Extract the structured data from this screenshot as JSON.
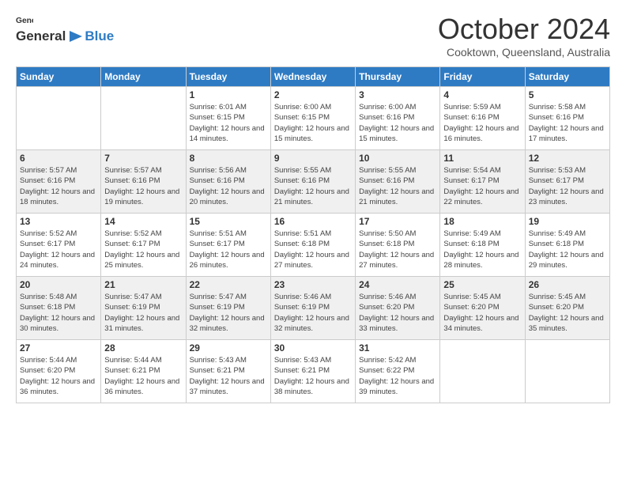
{
  "logo": {
    "general": "General",
    "blue": "Blue"
  },
  "header": {
    "title": "October 2024",
    "subtitle": "Cooktown, Queensland, Australia"
  },
  "weekdays": [
    "Sunday",
    "Monday",
    "Tuesday",
    "Wednesday",
    "Thursday",
    "Friday",
    "Saturday"
  ],
  "weeks": [
    [
      null,
      null,
      {
        "day": "1",
        "sunrise": "Sunrise: 6:01 AM",
        "sunset": "Sunset: 6:15 PM",
        "daylight": "Daylight: 12 hours and 14 minutes."
      },
      {
        "day": "2",
        "sunrise": "Sunrise: 6:00 AM",
        "sunset": "Sunset: 6:15 PM",
        "daylight": "Daylight: 12 hours and 15 minutes."
      },
      {
        "day": "3",
        "sunrise": "Sunrise: 6:00 AM",
        "sunset": "Sunset: 6:16 PM",
        "daylight": "Daylight: 12 hours and 15 minutes."
      },
      {
        "day": "4",
        "sunrise": "Sunrise: 5:59 AM",
        "sunset": "Sunset: 6:16 PM",
        "daylight": "Daylight: 12 hours and 16 minutes."
      },
      {
        "day": "5",
        "sunrise": "Sunrise: 5:58 AM",
        "sunset": "Sunset: 6:16 PM",
        "daylight": "Daylight: 12 hours and 17 minutes."
      }
    ],
    [
      {
        "day": "6",
        "sunrise": "Sunrise: 5:57 AM",
        "sunset": "Sunset: 6:16 PM",
        "daylight": "Daylight: 12 hours and 18 minutes."
      },
      {
        "day": "7",
        "sunrise": "Sunrise: 5:57 AM",
        "sunset": "Sunset: 6:16 PM",
        "daylight": "Daylight: 12 hours and 19 minutes."
      },
      {
        "day": "8",
        "sunrise": "Sunrise: 5:56 AM",
        "sunset": "Sunset: 6:16 PM",
        "daylight": "Daylight: 12 hours and 20 minutes."
      },
      {
        "day": "9",
        "sunrise": "Sunrise: 5:55 AM",
        "sunset": "Sunset: 6:16 PM",
        "daylight": "Daylight: 12 hours and 21 minutes."
      },
      {
        "day": "10",
        "sunrise": "Sunrise: 5:55 AM",
        "sunset": "Sunset: 6:16 PM",
        "daylight": "Daylight: 12 hours and 21 minutes."
      },
      {
        "day": "11",
        "sunrise": "Sunrise: 5:54 AM",
        "sunset": "Sunset: 6:17 PM",
        "daylight": "Daylight: 12 hours and 22 minutes."
      },
      {
        "day": "12",
        "sunrise": "Sunrise: 5:53 AM",
        "sunset": "Sunset: 6:17 PM",
        "daylight": "Daylight: 12 hours and 23 minutes."
      }
    ],
    [
      {
        "day": "13",
        "sunrise": "Sunrise: 5:52 AM",
        "sunset": "Sunset: 6:17 PM",
        "daylight": "Daylight: 12 hours and 24 minutes."
      },
      {
        "day": "14",
        "sunrise": "Sunrise: 5:52 AM",
        "sunset": "Sunset: 6:17 PM",
        "daylight": "Daylight: 12 hours and 25 minutes."
      },
      {
        "day": "15",
        "sunrise": "Sunrise: 5:51 AM",
        "sunset": "Sunset: 6:17 PM",
        "daylight": "Daylight: 12 hours and 26 minutes."
      },
      {
        "day": "16",
        "sunrise": "Sunrise: 5:51 AM",
        "sunset": "Sunset: 6:18 PM",
        "daylight": "Daylight: 12 hours and 27 minutes."
      },
      {
        "day": "17",
        "sunrise": "Sunrise: 5:50 AM",
        "sunset": "Sunset: 6:18 PM",
        "daylight": "Daylight: 12 hours and 27 minutes."
      },
      {
        "day": "18",
        "sunrise": "Sunrise: 5:49 AM",
        "sunset": "Sunset: 6:18 PM",
        "daylight": "Daylight: 12 hours and 28 minutes."
      },
      {
        "day": "19",
        "sunrise": "Sunrise: 5:49 AM",
        "sunset": "Sunset: 6:18 PM",
        "daylight": "Daylight: 12 hours and 29 minutes."
      }
    ],
    [
      {
        "day": "20",
        "sunrise": "Sunrise: 5:48 AM",
        "sunset": "Sunset: 6:18 PM",
        "daylight": "Daylight: 12 hours and 30 minutes."
      },
      {
        "day": "21",
        "sunrise": "Sunrise: 5:47 AM",
        "sunset": "Sunset: 6:19 PM",
        "daylight": "Daylight: 12 hours and 31 minutes."
      },
      {
        "day": "22",
        "sunrise": "Sunrise: 5:47 AM",
        "sunset": "Sunset: 6:19 PM",
        "daylight": "Daylight: 12 hours and 32 minutes."
      },
      {
        "day": "23",
        "sunrise": "Sunrise: 5:46 AM",
        "sunset": "Sunset: 6:19 PM",
        "daylight": "Daylight: 12 hours and 32 minutes."
      },
      {
        "day": "24",
        "sunrise": "Sunrise: 5:46 AM",
        "sunset": "Sunset: 6:20 PM",
        "daylight": "Daylight: 12 hours and 33 minutes."
      },
      {
        "day": "25",
        "sunrise": "Sunrise: 5:45 AM",
        "sunset": "Sunset: 6:20 PM",
        "daylight": "Daylight: 12 hours and 34 minutes."
      },
      {
        "day": "26",
        "sunrise": "Sunrise: 5:45 AM",
        "sunset": "Sunset: 6:20 PM",
        "daylight": "Daylight: 12 hours and 35 minutes."
      }
    ],
    [
      {
        "day": "27",
        "sunrise": "Sunrise: 5:44 AM",
        "sunset": "Sunset: 6:20 PM",
        "daylight": "Daylight: 12 hours and 36 minutes."
      },
      {
        "day": "28",
        "sunrise": "Sunrise: 5:44 AM",
        "sunset": "Sunset: 6:21 PM",
        "daylight": "Daylight: 12 hours and 36 minutes."
      },
      {
        "day": "29",
        "sunrise": "Sunrise: 5:43 AM",
        "sunset": "Sunset: 6:21 PM",
        "daylight": "Daylight: 12 hours and 37 minutes."
      },
      {
        "day": "30",
        "sunrise": "Sunrise: 5:43 AM",
        "sunset": "Sunset: 6:21 PM",
        "daylight": "Daylight: 12 hours and 38 minutes."
      },
      {
        "day": "31",
        "sunrise": "Sunrise: 5:42 AM",
        "sunset": "Sunset: 6:22 PM",
        "daylight": "Daylight: 12 hours and 39 minutes."
      },
      null,
      null
    ]
  ]
}
